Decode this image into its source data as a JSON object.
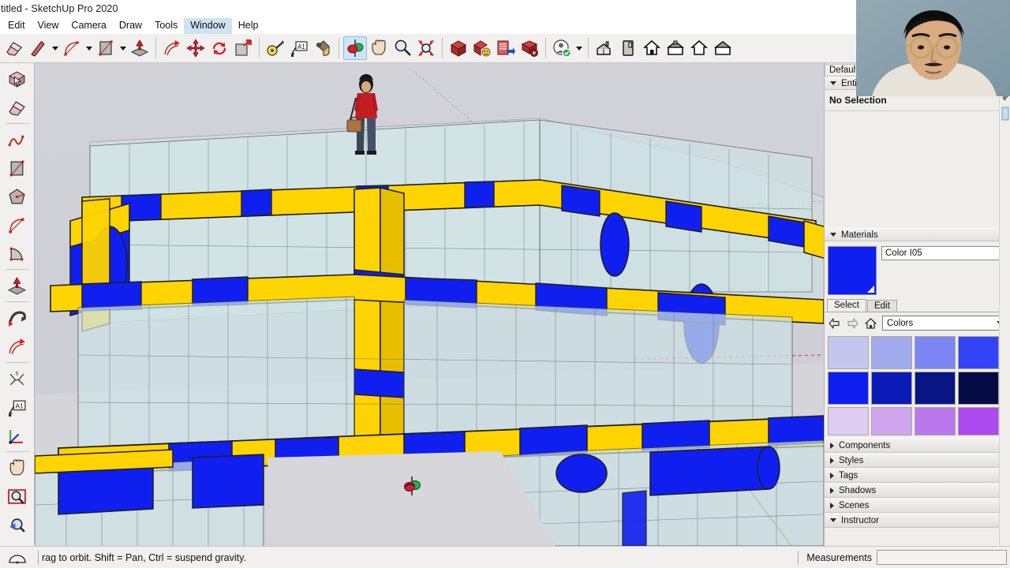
{
  "app": {
    "title": "titled - SketchUp Pro 2020",
    "menu": [
      {
        "label": "Edit",
        "active": false
      },
      {
        "label": "View",
        "active": false
      },
      {
        "label": "Camera",
        "active": false
      },
      {
        "label": "Draw",
        "active": false
      },
      {
        "label": "Tools",
        "active": false
      },
      {
        "label": "Window",
        "active": true
      },
      {
        "label": "Help",
        "active": false
      }
    ]
  },
  "toolbar": {
    "items": [
      {
        "name": "eraser-icon",
        "label": "Eraser"
      },
      {
        "name": "line-icon",
        "label": "Line",
        "caret": true
      },
      {
        "name": "arc-icon",
        "label": "Arc",
        "caret": true
      },
      {
        "name": "rectangle-icon",
        "label": "Rectangle",
        "caret": true
      },
      {
        "name": "pushpull-icon",
        "label": "Push/Pull"
      },
      {
        "name": "offset-icon",
        "label": "Offset"
      },
      {
        "name": "move-icon",
        "label": "Move"
      },
      {
        "name": "rotate-icon",
        "label": "Rotate"
      },
      {
        "name": "scale-icon",
        "label": "Scale"
      },
      {
        "name": "tape-measure-icon",
        "label": "Tape Measure"
      },
      {
        "name": "text-icon",
        "label": "Text"
      },
      {
        "name": "paint-bucket-icon",
        "label": "Paint Bucket"
      },
      {
        "name": "orbit-icon",
        "label": "Orbit",
        "active": true
      },
      {
        "name": "pan-icon",
        "label": "Pan"
      },
      {
        "name": "zoom-icon",
        "label": "Zoom"
      },
      {
        "name": "zoom-extents-icon",
        "label": "Zoom Extents"
      },
      {
        "name": "warehouse-3d-icon",
        "label": "3D Warehouse"
      },
      {
        "name": "share-model-icon",
        "label": "Share Model"
      },
      {
        "name": "extension-warehouse-icon",
        "label": "Extension Warehouse"
      },
      {
        "name": "extension-manager-icon",
        "label": "Extension Manager"
      },
      {
        "name": "account-icon",
        "label": "Account",
        "caret": true
      },
      {
        "name": "view-iso-icon",
        "label": "Iso"
      },
      {
        "name": "view-top-icon",
        "label": "Top"
      },
      {
        "name": "view-front-icon",
        "label": "Front"
      },
      {
        "name": "view-right-icon",
        "label": "Right"
      },
      {
        "name": "view-back-icon",
        "label": "Back"
      },
      {
        "name": "view-left-icon",
        "label": "Left"
      }
    ]
  },
  "left_toolbar": {
    "items": [
      {
        "name": "select-icon",
        "label": "Select"
      },
      {
        "name": "eraser-icon",
        "label": "Eraser"
      },
      {
        "name": "freehand-icon",
        "label": "Freehand"
      },
      {
        "name": "rectangle-icon",
        "label": "Rectangle"
      },
      {
        "name": "polygon-icon",
        "label": "Polygon"
      },
      {
        "name": "arc-icon",
        "label": "Arc"
      },
      {
        "name": "pie-icon",
        "label": "Pie"
      },
      {
        "name": "pushpull-icon",
        "label": "Push/Pull"
      },
      {
        "name": "followme-icon",
        "label": "Follow Me"
      },
      {
        "name": "offset-icon",
        "label": "Offset"
      },
      {
        "name": "dimension-icon",
        "label": "Dimension"
      },
      {
        "name": "text-icon",
        "label": "Text"
      },
      {
        "name": "axes-icon",
        "label": "Axes"
      },
      {
        "name": "pan-icon",
        "label": "Pan"
      },
      {
        "name": "zoom-window-icon",
        "label": "Zoom Window"
      },
      {
        "name": "previous-view-icon",
        "label": "Previous View"
      },
      {
        "name": "position-camera-icon",
        "label": "Position Camera"
      }
    ]
  },
  "tray": {
    "tab_label": "Default",
    "entity_info": {
      "title": "Entity Info",
      "expanded": true,
      "selection_text": "No Selection"
    },
    "materials": {
      "title": "Materials",
      "expanded": true,
      "current_material": "Color I05",
      "current_color": "#0f1ff0",
      "tabs": [
        {
          "label": "Select",
          "selected": true
        },
        {
          "label": "Edit",
          "selected": false
        }
      ],
      "library": "Colors",
      "nav": {
        "back": "back-arrow-icon",
        "forward": "forward-arrow-icon",
        "home": "home-icon"
      },
      "swatches": [
        "#c3c7f0",
        "#a0aaec",
        "#7b86f3",
        "#3244f6",
        "#0f1ff0",
        "#0b1bb8",
        "#081585",
        "#050b44",
        "#ddcdf2",
        "#cfa6ee",
        "#b977ec",
        "#ae49ef"
      ]
    },
    "panels": [
      {
        "label": "Components",
        "expanded": false
      },
      {
        "label": "Styles",
        "expanded": false
      },
      {
        "label": "Tags",
        "expanded": false
      },
      {
        "label": "Shadows",
        "expanded": false
      },
      {
        "label": "Scenes",
        "expanded": false
      },
      {
        "label": "Instructor",
        "expanded": true
      }
    ]
  },
  "statusbar": {
    "hint": "rag to orbit. Shift = Pan, Ctrl = suspend gravity.",
    "measurements_label": "Measurements",
    "measurements_value": ""
  },
  "viewport": {
    "background": "#cfcfd6",
    "ground": "#d6d6da",
    "colors": {
      "yellow": "#ffd400",
      "blue": "#0f1ff0",
      "glass": "#cfe4e7",
      "outline": "#202020",
      "axis_green": "#00a000",
      "axis_red": "#c00000",
      "axis_blue": "#0000c0"
    },
    "active_tool": "Orbit",
    "cursor_name": "orbit-cursor"
  }
}
